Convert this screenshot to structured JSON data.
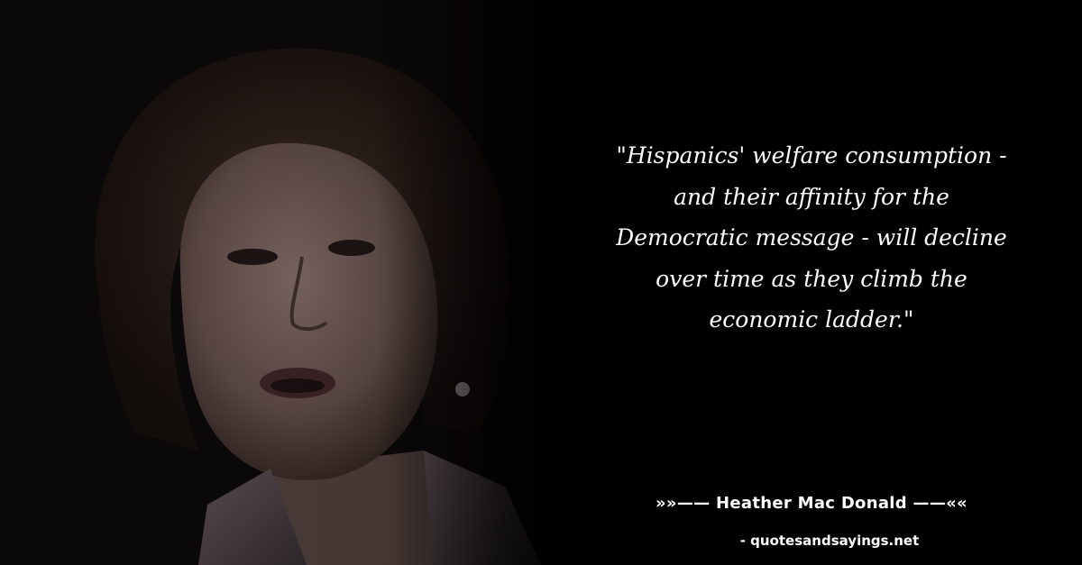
{
  "quote": {
    "lines": [
      "\"Hispanics' welfare consumption -",
      "and their affinity for the",
      "Democratic message - will decline",
      "over time as they climb the",
      "economic ladder.\""
    ]
  },
  "author": {
    "prefix": "»»——",
    "name": "Heather Mac Donald",
    "suffix": "——««"
  },
  "source": "- quotesandsayings.net",
  "colors": {
    "background": "#000000",
    "text": "#ffffff"
  }
}
